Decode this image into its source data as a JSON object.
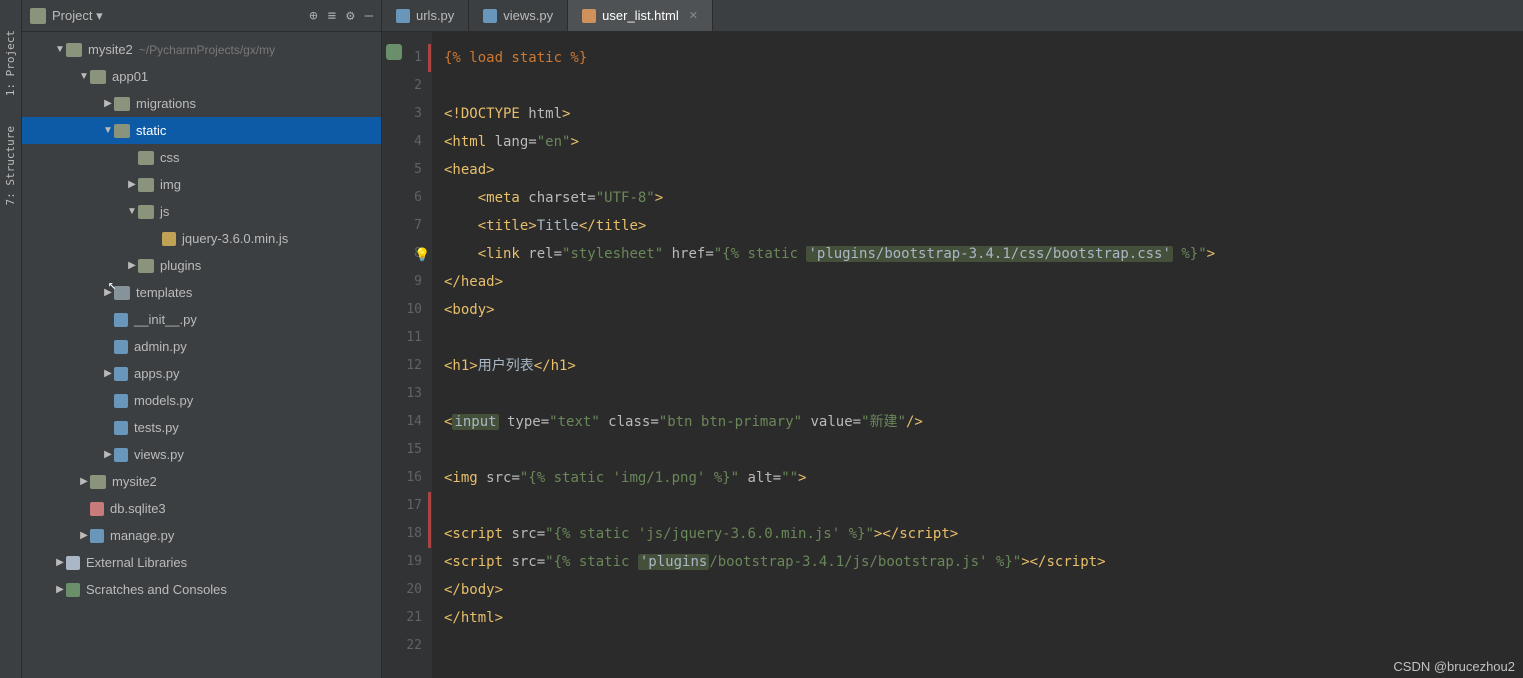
{
  "sidebar_left": {
    "project": "1: Project",
    "structure": "7: Structure"
  },
  "project_header": {
    "title": "Project",
    "dropdown": "▾"
  },
  "tree": [
    {
      "indent": 1,
      "arrow": "▼",
      "icon": "folder-icon",
      "label": "mysite2",
      "path": "~/PycharmProjects/gx/my"
    },
    {
      "indent": 2,
      "arrow": "▼",
      "icon": "folder-icon",
      "label": "app01"
    },
    {
      "indent": 3,
      "arrow": "▶",
      "icon": "folder-icon",
      "label": "migrations"
    },
    {
      "indent": 3,
      "arrow": "▼",
      "icon": "folder-icon",
      "label": "static",
      "selected": true
    },
    {
      "indent": 4,
      "arrow": "",
      "icon": "folder-icon",
      "label": "css"
    },
    {
      "indent": 4,
      "arrow": "▶",
      "icon": "folder-icon",
      "label": "img"
    },
    {
      "indent": 4,
      "arrow": "▼",
      "icon": "folder-icon",
      "label": "js"
    },
    {
      "indent": 5,
      "arrow": "",
      "icon": "js-icon",
      "label": "jquery-3.6.0.min.js"
    },
    {
      "indent": 4,
      "arrow": "▶",
      "icon": "folder-icon",
      "label": "plugins"
    },
    {
      "indent": 3,
      "arrow": "▶",
      "icon": "folder-icon-grey",
      "label": "templates"
    },
    {
      "indent": 3,
      "arrow": "",
      "icon": "py-icon",
      "label": "__init__.py"
    },
    {
      "indent": 3,
      "arrow": "",
      "icon": "py-icon",
      "label": "admin.py"
    },
    {
      "indent": 3,
      "arrow": "▶",
      "icon": "py-icon",
      "label": "apps.py"
    },
    {
      "indent": 3,
      "arrow": "",
      "icon": "py-icon",
      "label": "models.py"
    },
    {
      "indent": 3,
      "arrow": "",
      "icon": "py-icon",
      "label": "tests.py"
    },
    {
      "indent": 3,
      "arrow": "▶",
      "icon": "py-icon",
      "label": "views.py"
    },
    {
      "indent": 2,
      "arrow": "▶",
      "icon": "folder-icon",
      "label": "mysite2"
    },
    {
      "indent": 2,
      "arrow": "",
      "icon": "db-icon",
      "label": "db.sqlite3"
    },
    {
      "indent": 2,
      "arrow": "▶",
      "icon": "py-icon",
      "label": "manage.py"
    },
    {
      "indent": 1,
      "arrow": "▶",
      "icon": "lib-icon",
      "label": "External Libraries"
    },
    {
      "indent": 1,
      "arrow": "▶",
      "icon": "scratch-icon",
      "label": "Scratches and Consoles"
    }
  ],
  "tabs": [
    {
      "icon": "py",
      "label": "urls.py"
    },
    {
      "icon": "py",
      "label": "views.py"
    },
    {
      "icon": "html",
      "label": "user_list.html",
      "active": true
    }
  ],
  "line_numbers": [
    "1",
    "2",
    "3",
    "4",
    "5",
    "6",
    "7",
    "8",
    "9",
    "10",
    "11",
    "12",
    "13",
    "14",
    "15",
    "16",
    "17",
    "18",
    "19",
    "20",
    "21",
    "22"
  ],
  "red_markers": [
    1,
    17,
    18
  ],
  "code": {
    "l1": {
      "t1": "{% load static %}"
    },
    "l3": {
      "t1": "<!DOCTYPE ",
      "attr": "html",
      "t2": ">"
    },
    "l4": {
      "t1": "<html ",
      "attr": "lang=",
      "str": "\"en\"",
      "t2": ">"
    },
    "l5": {
      "t1": "<head>"
    },
    "l6": {
      "t1": "    <meta ",
      "attr": "charset=",
      "str": "\"UTF-8\"",
      "t2": ">"
    },
    "l7": {
      "t1": "    <title>",
      "text": "Title",
      "t2": "</title>"
    },
    "l8": {
      "t1": "    <link ",
      "attr1": "rel=",
      "str1": "\"stylesheet\"",
      "attr2": " href=",
      "str2a": "\"{% static ",
      "hl": "'plugins/bootstrap-3.4.1/css/bootstrap.css'",
      "str2b": " %}\"",
      "t2": ">"
    },
    "l9": {
      "t1": "</head>"
    },
    "l10": {
      "t1": "<body>"
    },
    "l12": {
      "t1": "<h1>",
      "text": "用户列表",
      "t2": "</h1>"
    },
    "l14": {
      "t1": "<",
      "hl": "input",
      "attr1": " type=",
      "str1": "\"text\"",
      "attr2": " class=",
      "str2": "\"btn btn-primary\"",
      "attr3": " value=",
      "str3": "\"新建\"",
      "t2": "/>"
    },
    "l16": {
      "t1": "<img ",
      "attr1": "src=",
      "str1": "\"{% static ",
      "str1b": "'img/1.png'",
      "str1c": " %}\"",
      "attr2": " alt=",
      "str2": "\"\"",
      "t2": ">"
    },
    "l18": {
      "t1": "<script ",
      "attr": "src=",
      "str1": "\"{% static ",
      "str1b": "'js/jquery-3.6.0.min.js'",
      "str1c": " %}\"",
      "t2": "></",
      "t3": "script",
      "t4": ">"
    },
    "l19": {
      "t1": "<script ",
      "attr": "src=",
      "str1": "\"{% static ",
      "hl": "'plugins",
      "str1b": "/bootstrap-3.4.1/js/bootstrap.js'",
      "str1c": " %}\"",
      "t2": "></",
      "t3": "script",
      "t4": ">"
    },
    "l20": {
      "t1": "</body>"
    },
    "l21": {
      "t1": "</html>"
    }
  },
  "watermark": "CSDN @brucezhou2"
}
